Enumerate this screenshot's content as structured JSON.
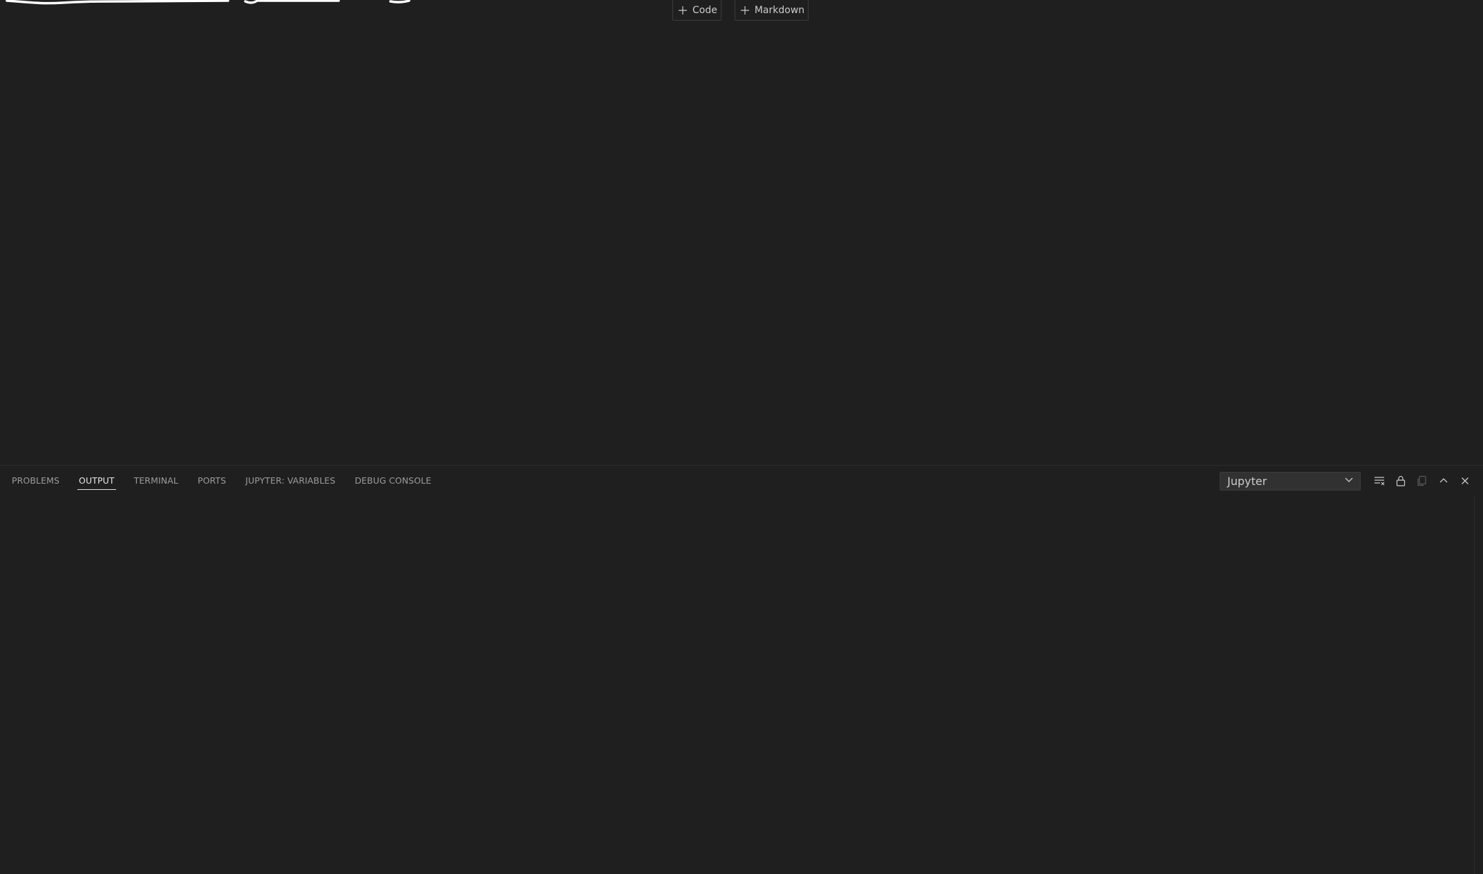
{
  "editor": {
    "add_code_label": "Code",
    "add_markdown_label": "Markdown"
  },
  "panel": {
    "tabs": [
      {
        "label": "PROBLEMS"
      },
      {
        "label": "OUTPUT"
      },
      {
        "label": "TERMINAL"
      },
      {
        "label": "PORTS"
      },
      {
        "label": "JUPYTER: VARIABLES"
      },
      {
        "label": "DEBUG CONSOLE"
      }
    ],
    "active_tab": "OUTPUT",
    "output_channel": "Jupyter",
    "icons": [
      "clear-output-icon",
      "lock-icon",
      "copy-icon",
      "chevron-up-icon",
      "close-icon"
    ]
  },
  "colors": {
    "background": "#1f1f1f",
    "active_tab": "#e7e7e7",
    "inactive_tab": "#9d9d9d"
  }
}
